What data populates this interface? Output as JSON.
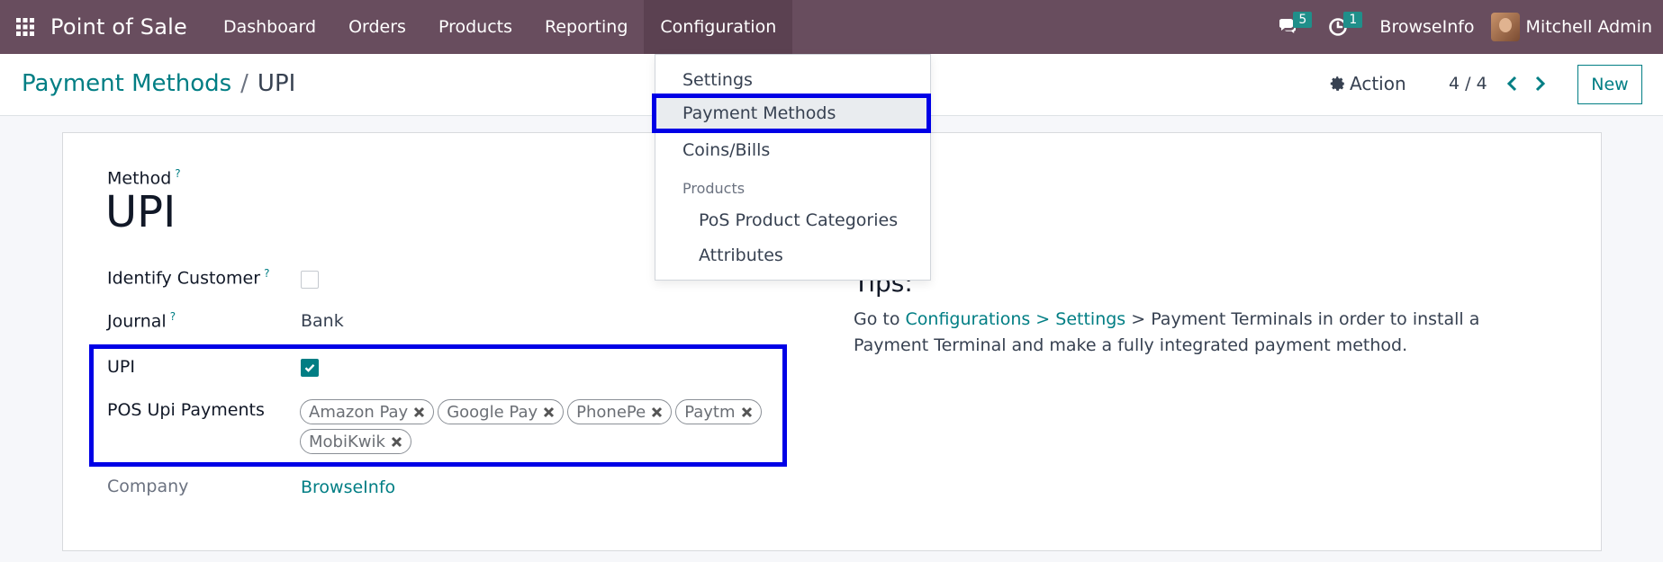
{
  "nav": {
    "app_name": "Point of Sale",
    "menus": [
      "Dashboard",
      "Orders",
      "Products",
      "Reporting",
      "Configuration"
    ],
    "messages_count": "5",
    "activities_count": "1",
    "company": "BrowseInfo",
    "user": "Mitchell Admin"
  },
  "control": {
    "breadcrumb_parent": "Payment Methods",
    "breadcrumb_sep": "/",
    "breadcrumb_current": "UPI",
    "action_label": "Action",
    "pager": "4 / 4",
    "new_label": "New"
  },
  "form": {
    "method_label": "Method",
    "help_mark": "?",
    "method_name": "UPI",
    "identify_customer_label": "Identify Customer",
    "identify_customer_checked": false,
    "journal_label": "Journal",
    "journal_value": "Bank",
    "upi_label": "UPI",
    "upi_checked": true,
    "pos_upi_payments_label": "POS Upi Payments",
    "pos_upi_payments": [
      "Amazon Pay",
      "Google Pay",
      "PhonePe",
      "Paytm",
      "MobiKwik"
    ],
    "company_label": "Company",
    "company_value": "BrowseInfo"
  },
  "tips": {
    "title": "Tips:",
    "text_before": "Go to ",
    "link": "Configurations > Settings",
    "text_after": " > Payment Terminals in order to install a Payment Terminal and make a fully integrated payment method."
  },
  "dropdown": {
    "settings": "Settings",
    "payment_methods": "Payment Methods",
    "coins_bills": "Coins/Bills",
    "products_header": "Products",
    "pos_product_categories": "PoS Product Categories",
    "attributes": "Attributes"
  },
  "colors": {
    "navbar": "#684d5e",
    "accent": "#017e84",
    "highlight": "#0000e6",
    "badge": "#1f8f8a"
  }
}
